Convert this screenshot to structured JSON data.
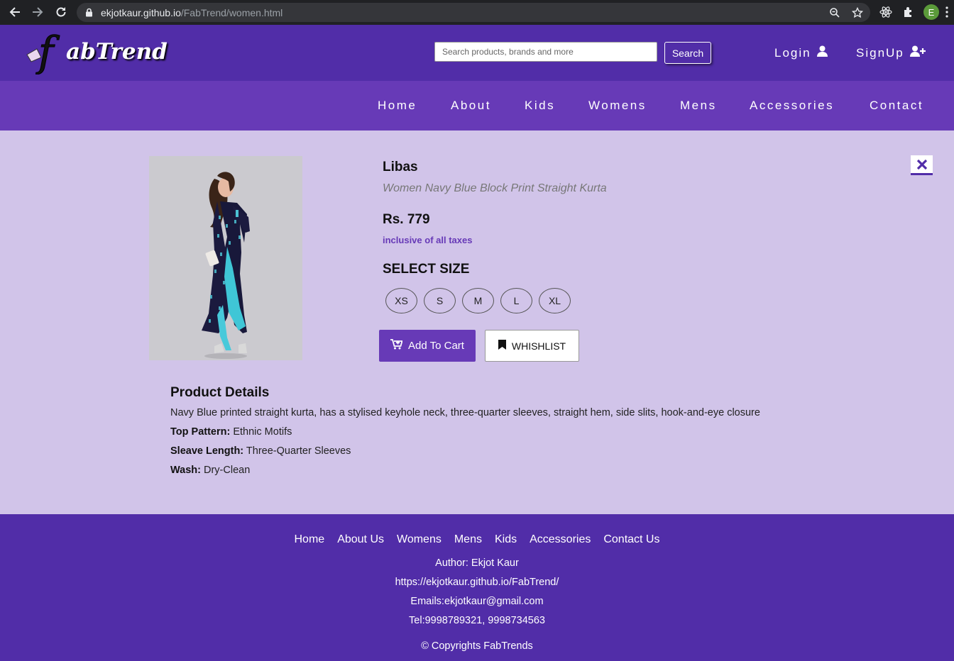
{
  "browser": {
    "url_host": "ekjotkaur.github.io",
    "url_path": "/FabTrend/women.html",
    "profile_initial": "E"
  },
  "header": {
    "logo_text": "fabTrend",
    "search_placeholder": "Search products, brands and more",
    "search_button": "Search",
    "login": "Login",
    "signup": "SignUp"
  },
  "nav": {
    "items": [
      "Home",
      "About",
      "Kids",
      "Womens",
      "Mens",
      "Accessories",
      "Contact"
    ]
  },
  "product": {
    "brand": "Libas",
    "name": "Women Navy Blue Block Print Straight Kurta",
    "price": "Rs. 779",
    "tax_note": "inclusive of all taxes",
    "select_size_label": "SELECT SIZE",
    "sizes": [
      "XS",
      "S",
      "M",
      "L",
      "XL"
    ],
    "add_to_cart": "Add To Cart",
    "wishlist": "WHISHLIST"
  },
  "details": {
    "title": "Product Details",
    "description": "Navy Blue printed straight kurta, has a stylised keyhole neck, three-quarter sleeves, straight hem, side slits, hook-and-eye closure",
    "rows": [
      {
        "label": "Top Pattern:",
        "value": "Ethnic Motifs"
      },
      {
        "label": "Sleave Length:",
        "value": "Three-Quarter Sleeves"
      },
      {
        "label": "Wash:",
        "value": "Dry-Clean"
      }
    ]
  },
  "footer": {
    "links": [
      "Home",
      "About Us",
      "Womens",
      "Mens",
      "Kids",
      "Accessories",
      "Contact Us"
    ],
    "author": "Author: Ekjot Kaur",
    "site": "https://ekjotkaur.github.io/FabTrend/",
    "email": "Emails:ekjotkaur@gmail.com",
    "tel": "Tel:9998789321, 9998734563",
    "copyright": "© Copyrights FabTrends"
  },
  "colors": {
    "header": "#512da8",
    "nav": "#673ab7",
    "page_bg": "#d1c4e9",
    "footer": "#512da8"
  }
}
